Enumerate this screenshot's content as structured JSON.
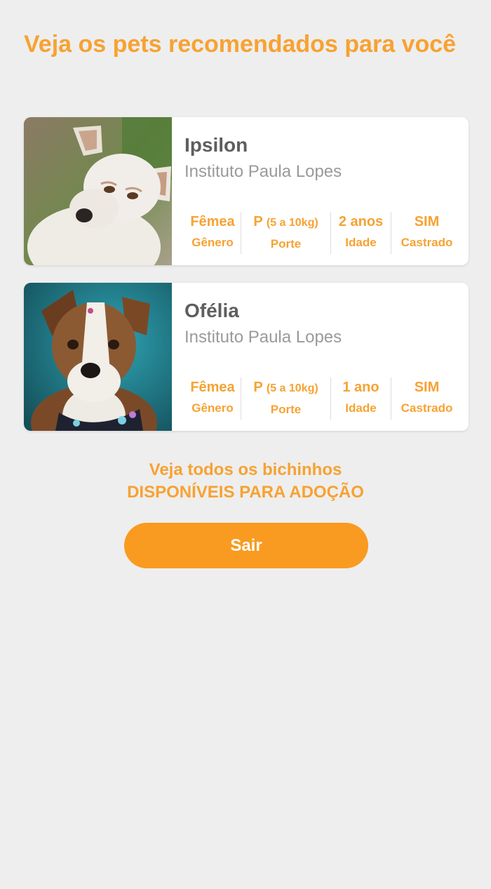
{
  "header": {
    "title": "Veja os pets recomendados para você"
  },
  "pets": [
    {
      "name": "Ipsilon",
      "organization": "Instituto Paula Lopes",
      "photo_icon": "dog-photo",
      "stats": {
        "gender_value": "Fêmea",
        "gender_label": "Gênero",
        "size_value": "P",
        "size_detail": "(5 a 10kg)",
        "size_label": "Porte",
        "age_value": "2 anos",
        "age_label": "Idade",
        "neutered_value": "SIM",
        "neutered_label": "Castrado"
      }
    },
    {
      "name": "Ofélia",
      "organization": "Instituto Paula Lopes",
      "photo_icon": "dog-photo",
      "stats": {
        "gender_value": "Fêmea",
        "gender_label": "Gênero",
        "size_value": "P",
        "size_detail": "(5 a 10kg)",
        "size_label": "Porte",
        "age_value": "1 ano",
        "age_label": "Idade",
        "neutered_value": "SIM",
        "neutered_label": "Castrado"
      }
    }
  ],
  "see_all": {
    "line1": "Veja todos os bichinhos",
    "line2": "DISPONÍVEIS PARA ADOÇÃO"
  },
  "exit_button": {
    "label": "Sair"
  },
  "colors": {
    "accent": "#f7a232",
    "button": "#f99b20",
    "background": "#eeeeee",
    "card": "#ffffff",
    "name_text": "#5e5e5e",
    "org_text": "#9a9a9a"
  }
}
